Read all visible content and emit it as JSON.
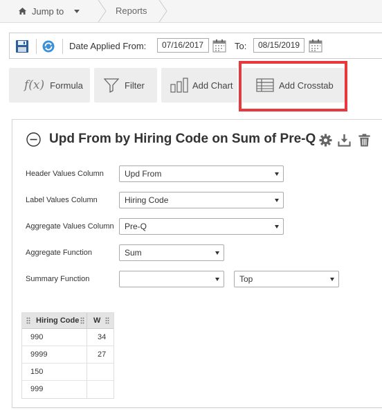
{
  "breadcrumb": {
    "jump_label": "Jump to",
    "reports_label": "Reports"
  },
  "toolbar": {
    "date_from_label": "Date Applied From:",
    "date_from": "07/16/2017",
    "date_to_label": "To:",
    "date_to": "08/15/2019"
  },
  "actions": {
    "formula": "Formula",
    "filter": "Filter",
    "add_chart": "Add Chart",
    "add_crosstab": "Add Crosstab"
  },
  "panel": {
    "title": "Upd From by Hiring Code on Sum of Pre-Q",
    "fields": {
      "header_values_label": "Header Values Column",
      "header_values": "Upd From",
      "label_values_label": "Label Values Column",
      "label_values": "Hiring Code",
      "aggregate_values_label": "Aggregate Values Column",
      "aggregate_values": "Pre-Q",
      "aggregate_function_label": "Aggregate Function",
      "aggregate_function": "Sum",
      "summary_function_label": "Summary Function",
      "summary_function": "",
      "summary_position": "Top"
    },
    "grid": {
      "col1": "Hiring Code",
      "col2": "W",
      "rows": [
        {
          "code": "990",
          "w": "34"
        },
        {
          "code": "9999",
          "w": "27"
        },
        {
          "code": "150",
          "w": ""
        },
        {
          "code": "999",
          "w": ""
        }
      ]
    }
  },
  "colors": {
    "highlight": "#e8383d",
    "button_bg": "#ededed",
    "save_blue": "#2a5f9e",
    "refresh_blue": "#3d8fd6"
  },
  "icons": [
    "home-icon",
    "chevron-down-icon",
    "save-icon",
    "refresh-icon",
    "calendar-icon",
    "function-icon",
    "filter-icon",
    "bar-chart-icon",
    "table-icon",
    "collapse-icon",
    "gear-icon",
    "download-icon",
    "trash-icon",
    "drag-handle-icon"
  ]
}
